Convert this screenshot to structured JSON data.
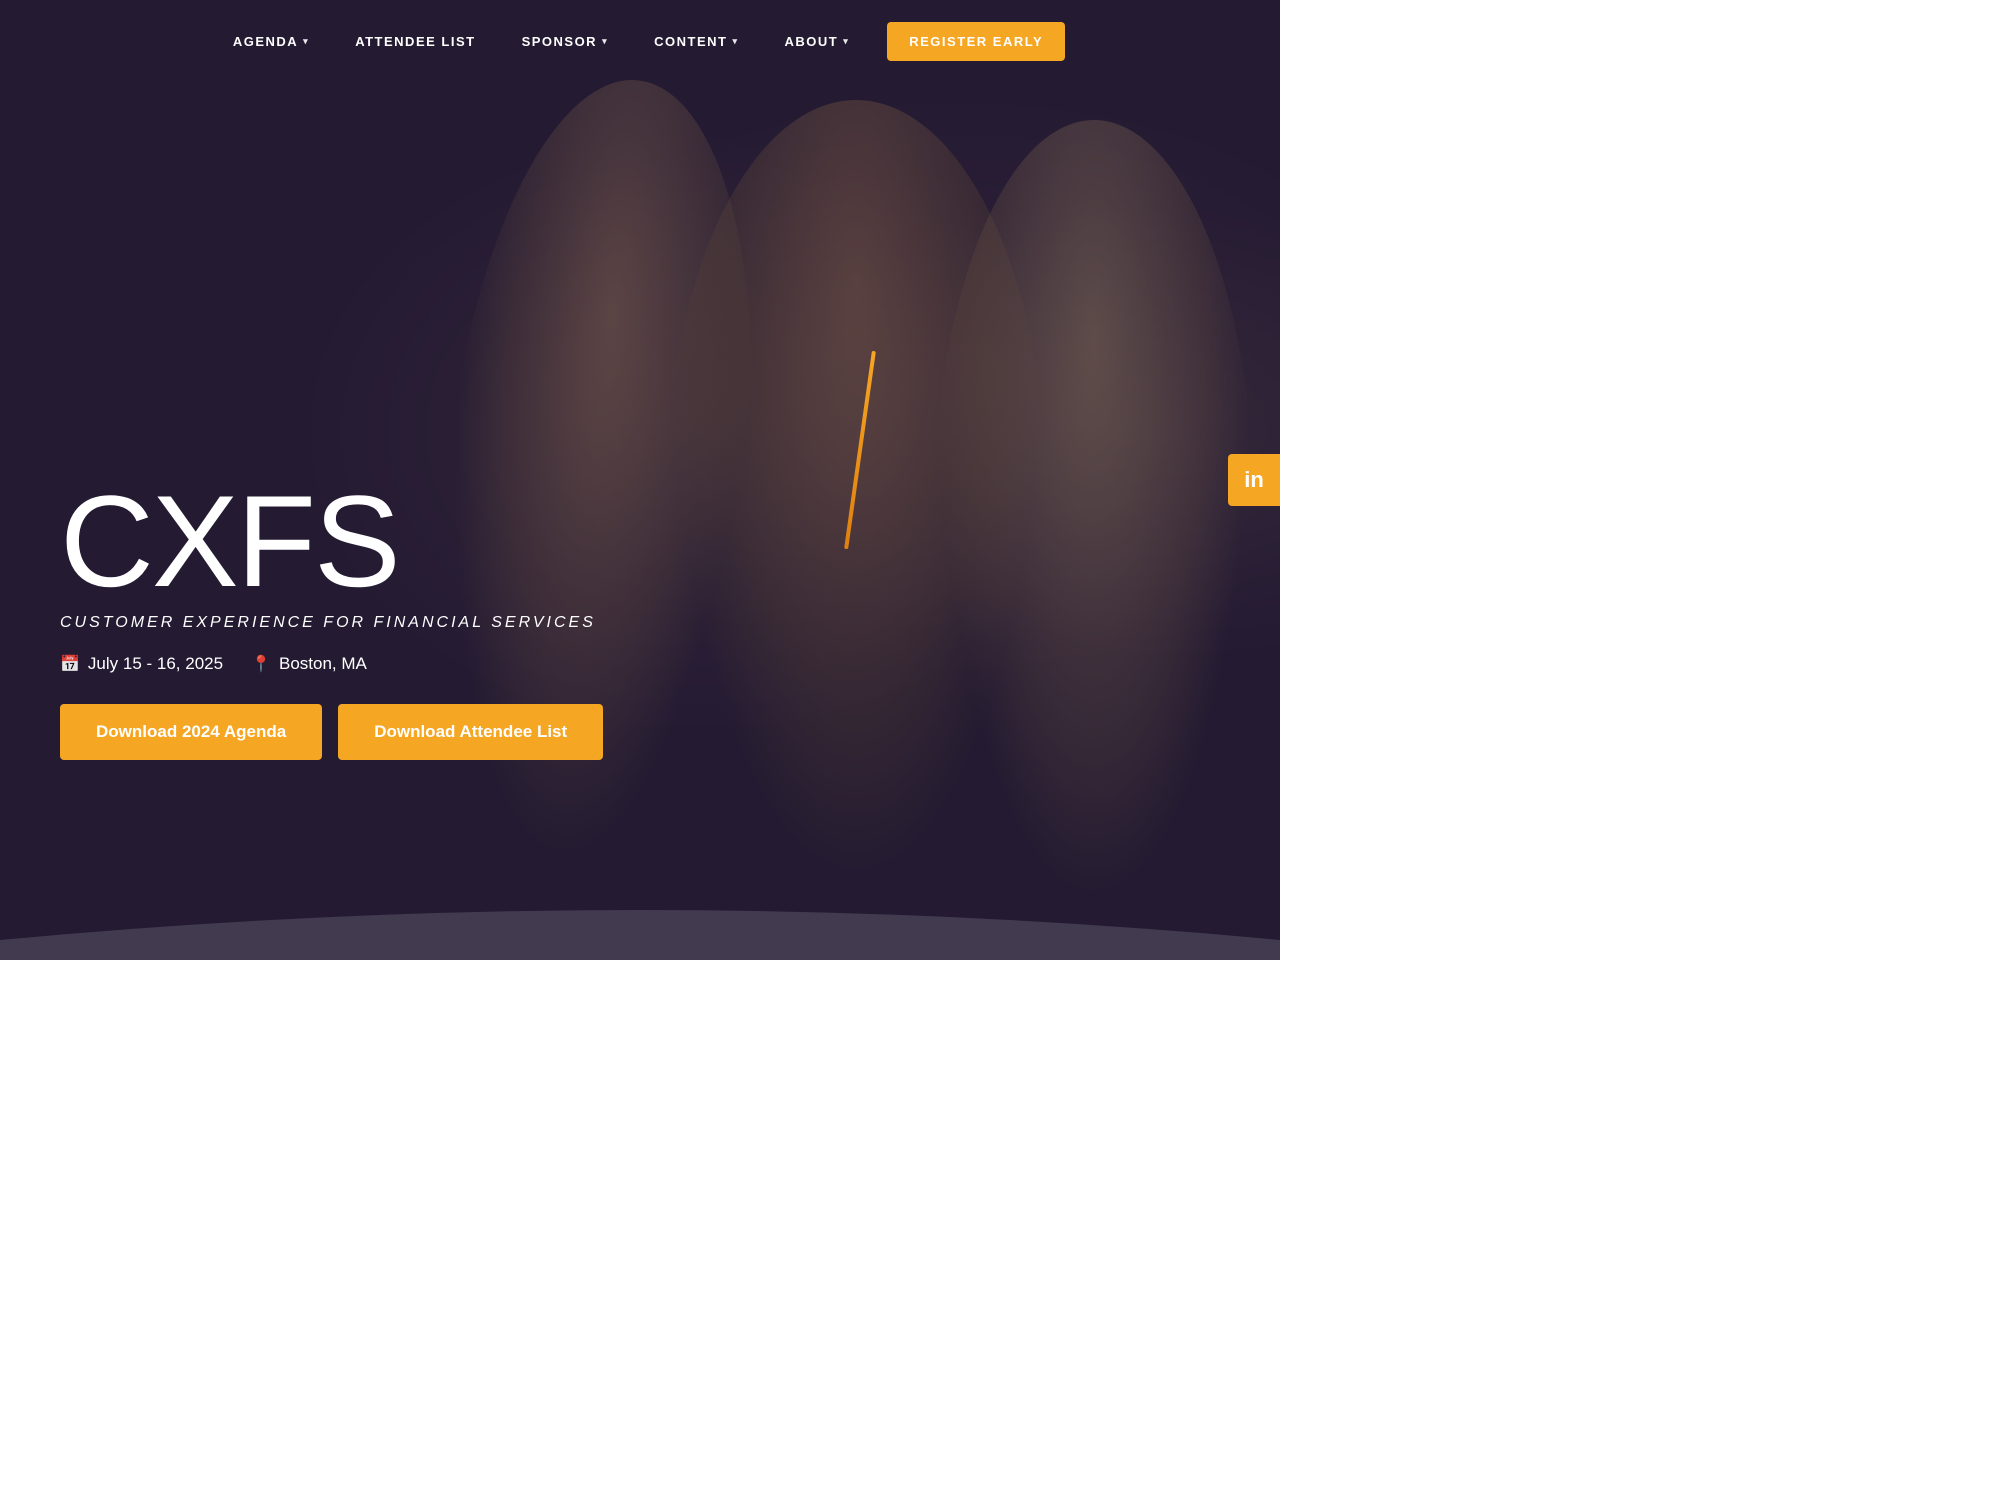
{
  "nav": {
    "items": [
      {
        "label": "AGENDA",
        "has_dropdown": true
      },
      {
        "label": "ATTENDEE LIST",
        "has_dropdown": false
      },
      {
        "label": "SPONSOR",
        "has_dropdown": true
      },
      {
        "label": "CONTENT",
        "has_dropdown": true
      },
      {
        "label": "ABOUT",
        "has_dropdown": true
      }
    ],
    "register_button": "REGISTER EARLY"
  },
  "hero": {
    "logo": "CXFS",
    "subtitle": "CUSTOMER EXPERIENCE FOR FINANCIAL SERVICES",
    "date_icon": "📅",
    "date": "July 15 - 16, 2025",
    "location_icon": "📍",
    "location": "Boston, MA",
    "btn1": "Download 2024 Agenda",
    "btn2": "Download Attendee List",
    "linkedin_icon": "in"
  },
  "colors": {
    "accent": "#f5a623",
    "overlay": "rgba(35,25,50,0.72)",
    "text_white": "#ffffff",
    "nav_bg": "transparent"
  }
}
